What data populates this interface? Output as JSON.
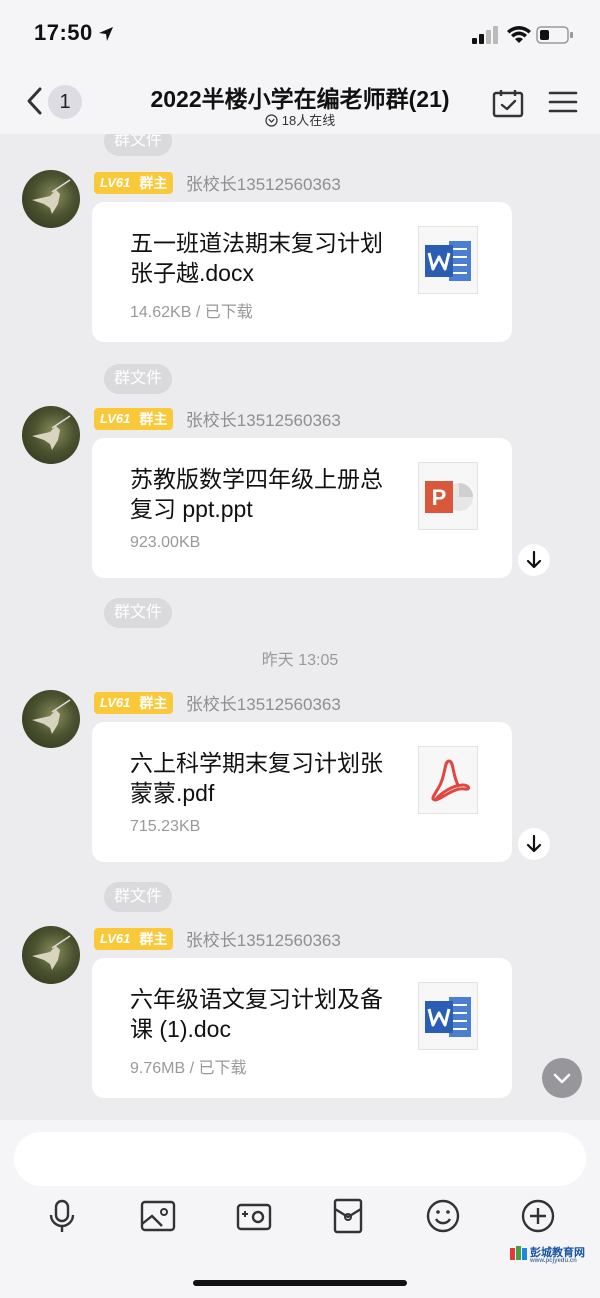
{
  "status_bar": {
    "time": "17:50"
  },
  "header": {
    "back_count": "1",
    "title": "2022半楼小学在编老师群(21)",
    "online": "18人在线"
  },
  "messages": [
    {
      "pill": "群文件",
      "level": "LV61",
      "role": "群主",
      "sender": "张校长13512560363",
      "file_name": "五一班道法期末复习计划 张子越.docx",
      "meta": "14.62KB / 已下载",
      "file_type": "word"
    },
    {
      "pill": "群文件",
      "level": "LV61",
      "role": "群主",
      "sender": "张校长13512560363",
      "file_name": "苏教版数学四年级上册总复习 ppt.ppt",
      "meta": "923.00KB",
      "file_type": "ppt"
    },
    {
      "pill": "群文件",
      "time": "昨天 13:05",
      "level": "LV61",
      "role": "群主",
      "sender": "张校长13512560363",
      "file_name": "六上科学期末复习计划张蒙蒙.pdf",
      "meta": "715.23KB",
      "file_type": "pdf"
    },
    {
      "pill": "群文件",
      "level": "LV61",
      "role": "群主",
      "sender": "张校长13512560363",
      "file_name": "六年级语文复习计划及备课 (1).doc",
      "meta": "9.76MB / 已下载",
      "file_type": "word"
    }
  ],
  "input": {
    "placeholder": ""
  },
  "toolbar": [
    "microphone-icon",
    "image-icon",
    "camera-icon",
    "red-packet-icon",
    "emoji-icon",
    "plus-icon"
  ],
  "watermark": {
    "text": "彭城教育网",
    "sub": "www.pcjyedu.cn"
  },
  "colors": {
    "badge": "#f9c93a",
    "word": "#2b5db4",
    "ppt": "#d9573a",
    "pdf": "#e0473f"
  }
}
